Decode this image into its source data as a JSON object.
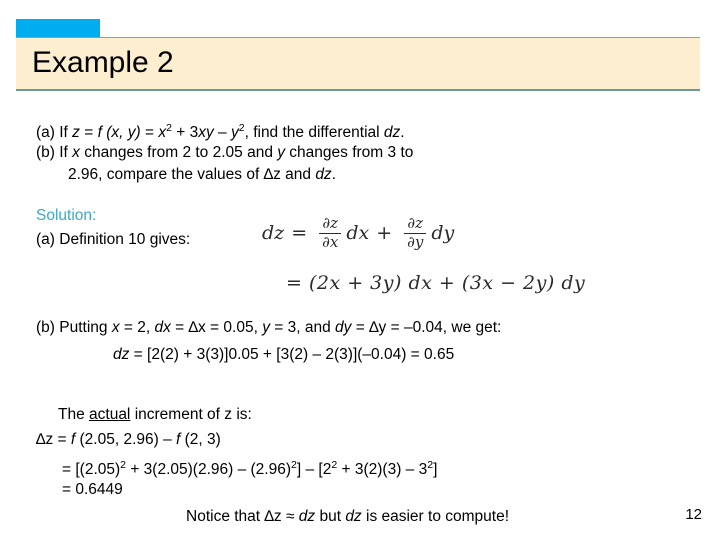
{
  "slide": {
    "title": "Example 2",
    "page_number": "12",
    "colors": {
      "accent_square": "#00AEEF",
      "banner_background": "#FDEED0",
      "banner_border": "#6F9A93",
      "solution_label": "#3BA8C8",
      "body_text": "#000000",
      "math_text": "#2B2B2B"
    }
  },
  "problem": {
    "part_a": {
      "prefix": "(a) If ",
      "line": "(a) If z = f (x, y) = x2 + 3xy – y2, find the differential dz.",
      "segments": {
        "lead": "(a) If ",
        "z": "z",
        "eq1": " = ",
        "f": "f",
        "args": " (x, y)",
        "eq2": " = ",
        "x": "x",
        "exp_x": "2",
        "plus": " + 3",
        "xy": "xy",
        "minus": " – ",
        "y": "y",
        "exp_y": "2",
        "tail": ", find the differential ",
        "dz": "dz",
        "period": "."
      }
    },
    "part_b": {
      "line_1": "(b) If x changes from 2 to 2.05 and y changes from 3 to",
      "line_2": "2.96, compare the values of ∆z and dz.",
      "l1_segments": {
        "lead": "(b) If ",
        "x": "x",
        "mid": " changes from 2 to 2.05 and ",
        "y": "y",
        "tail": " changes from 3 to"
      },
      "l2_segments": {
        "lead": "2.96, compare the values of ",
        "delta_z": "∆z",
        "mid": " and ",
        "dz": "dz",
        "period": "."
      }
    }
  },
  "solution": {
    "label": "Solution:",
    "part_a_lead": "(a)  Definition 10 gives:",
    "equation_1": {
      "lhs": "dz",
      "equals": "=",
      "term1_num": "∂z",
      "term1_den": "∂x",
      "term1_diff": "dx",
      "plus": "+",
      "term2_num": "∂z",
      "term2_den": "∂y",
      "term2_diff": "dy"
    },
    "equation_2": {
      "text": "= (2x + 3y) dx + (3x − 2y) dy"
    },
    "part_b": {
      "line_1": "(b)  Putting x = 2, dx = ∆x = 0.05, y = 3, and dy = ∆y = –0.04, we get:",
      "l1_segments": {
        "lead": "(b)  Putting ",
        "x": "x",
        "s1": " = 2, ",
        "dx": "dx",
        "s2": " = ",
        "delta_x": "∆x",
        "s3": " = 0.05, ",
        "y": "y",
        "s4": " = 3, and ",
        "dy": "dy",
        "s5": " = ",
        "delta_y": "∆y",
        "s6": " = –0.04, we get:"
      },
      "line_2": "dz = [2(2) + 3(3)]0.05 + [3(2) – 2(3)](–0.04) = 0.65",
      "l2_segments": {
        "dz": "dz",
        "rest": " = [2(2) + 3(3)]0.05 + [3(2) – 2(3)](–0.04) = 0.65"
      }
    }
  },
  "actual_increment": {
    "heading": {
      "lead": "The ",
      "emphasis": "actual",
      "tail": " increment of z is:"
    },
    "line_1": {
      "delta_z": "∆z",
      "eq": " = ",
      "f1": "f",
      "args1": " (2.05, 2.96)",
      "minus": " – ",
      "f2": "f",
      "args2": " (2, 3)"
    },
    "line_2": {
      "lead": "= [(2.05)",
      "exp1": "2",
      "mid1": " + 3(2.05)(2.96) – (2.96)",
      "exp2": "2",
      "mid2": "] – [2",
      "exp3": "2",
      "mid3": " + 3(2)(3) – 3",
      "exp4": "2",
      "tail": "]"
    },
    "line_3": "= 0.6449"
  },
  "notice": {
    "lead": "Notice that ",
    "delta_z": "∆z",
    "approx": " ≈ ",
    "dz": "dz",
    "tail": " but ",
    "dz2": "dz",
    "end": " is easier to compute!"
  }
}
